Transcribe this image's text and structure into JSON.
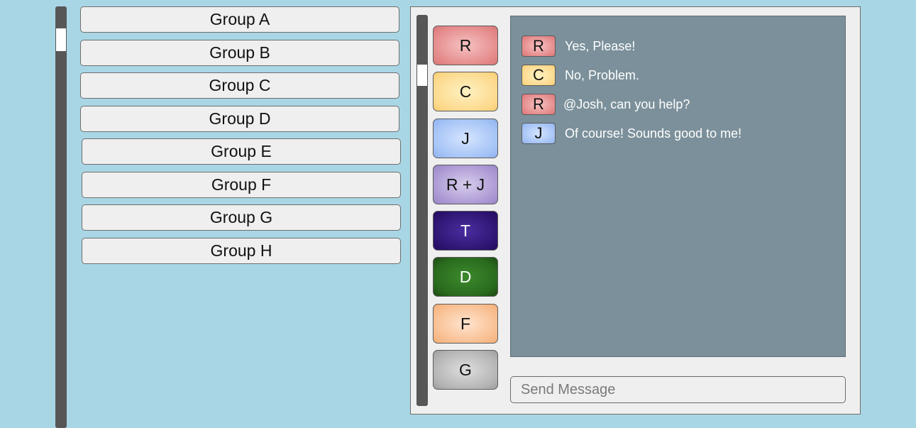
{
  "groups": [
    {
      "label": "Group A"
    },
    {
      "label": "Group B"
    },
    {
      "label": "Group C"
    },
    {
      "label": "Group D"
    },
    {
      "label": "Group E"
    },
    {
      "label": "Group F"
    },
    {
      "label": "Group G"
    },
    {
      "label": "Group H"
    }
  ],
  "users": [
    {
      "label": "R",
      "color": "#e48989"
    },
    {
      "label": "C",
      "color": "#fcd98c"
    },
    {
      "label": "J",
      "color": "#a3c2f5"
    },
    {
      "label": "R + J",
      "color": "#aa97d3"
    },
    {
      "label": "T",
      "color": "#2d1470"
    },
    {
      "label": "D",
      "color": "#2a6b1e"
    },
    {
      "label": "F",
      "color": "#f8bd8e"
    },
    {
      "label": "G",
      "color": "#b3b3b3"
    }
  ],
  "messages": [
    {
      "sender": "R",
      "text": "Yes, Please!"
    },
    {
      "sender": "C",
      "text": "No, Problem."
    },
    {
      "sender": "R",
      "text": "@Josh, can you help?"
    },
    {
      "sender": "J",
      "text": "Of course! Sounds good to me!"
    }
  ],
  "composer": {
    "placeholder": "Send Message"
  },
  "colors": {
    "background": "#a9d6e5",
    "message_panel": "#7b909a",
    "scrollbar": "#575757"
  }
}
